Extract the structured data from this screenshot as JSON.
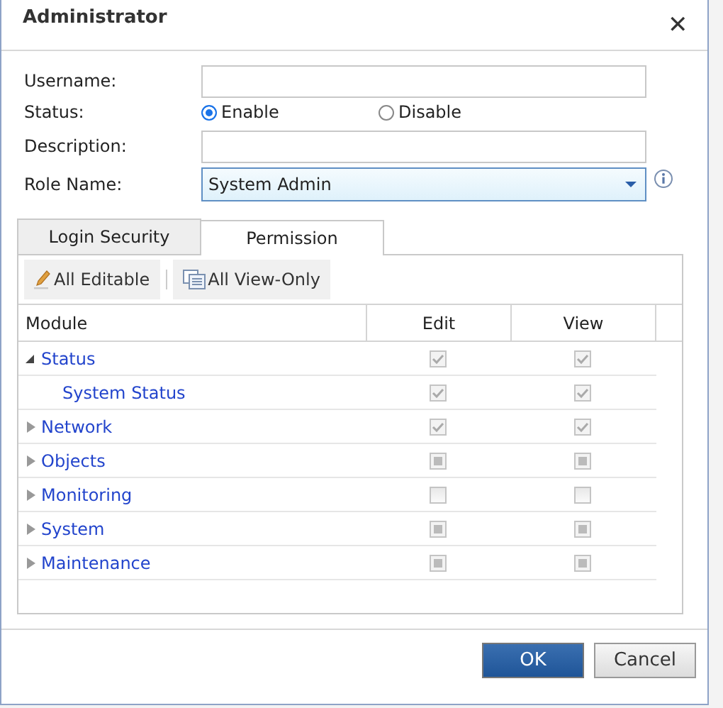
{
  "window": {
    "title": "Administrator",
    "close": "✕"
  },
  "form": {
    "fields": [
      {
        "kind": "text",
        "label": "Username:"
      },
      {
        "kind": "radio",
        "label": "Status:",
        "options": [
          {
            "label": "Enable",
            "selected": true
          },
          {
            "label": "Disable",
            "selected": false
          }
        ]
      },
      {
        "kind": "text",
        "label": "Description:"
      },
      {
        "kind": "select",
        "label": "Role Name:",
        "value": "System Admin"
      }
    ]
  },
  "tabs": [
    {
      "label": "Login Security",
      "selected": false
    },
    {
      "label": "Permission",
      "selected": true
    }
  ],
  "toolbar": [
    {
      "kind": "edit",
      "label": "All Editable"
    },
    {
      "kind": "view",
      "label": "All View-Only"
    }
  ],
  "table": {
    "columns": [
      "Module",
      "Edit",
      "View"
    ],
    "rows": [
      {
        "name": "Status",
        "expanded": true,
        "edit": {
          "checked": true,
          "partial": false
        },
        "view": {
          "checked": true,
          "partial": false
        },
        "children": [
          {
            "name": "System Status",
            "edit": {
              "checked": true,
              "partial": false
            },
            "view": {
              "checked": true,
              "partial": false
            }
          }
        ]
      },
      {
        "name": "Network",
        "expanded": false,
        "edit": {
          "checked": true,
          "partial": false
        },
        "view": {
          "checked": true,
          "partial": false
        }
      },
      {
        "name": "Objects",
        "expanded": false,
        "edit": {
          "checked": false,
          "partial": true
        },
        "view": {
          "checked": false,
          "partial": true
        }
      },
      {
        "name": "Monitoring",
        "expanded": false,
        "edit": {
          "checked": false,
          "partial": false
        },
        "view": {
          "checked": false,
          "partial": false
        }
      },
      {
        "name": "System",
        "expanded": false,
        "edit": {
          "checked": false,
          "partial": true
        },
        "view": {
          "checked": false,
          "partial": true
        }
      },
      {
        "name": "Maintenance",
        "expanded": false,
        "edit": {
          "checked": false,
          "partial": true
        },
        "view": {
          "checked": false,
          "partial": true
        }
      }
    ]
  },
  "buttons": [
    {
      "label": "OK",
      "kind": "primary"
    },
    {
      "label": "Cancel",
      "kind": "secondary"
    }
  ]
}
